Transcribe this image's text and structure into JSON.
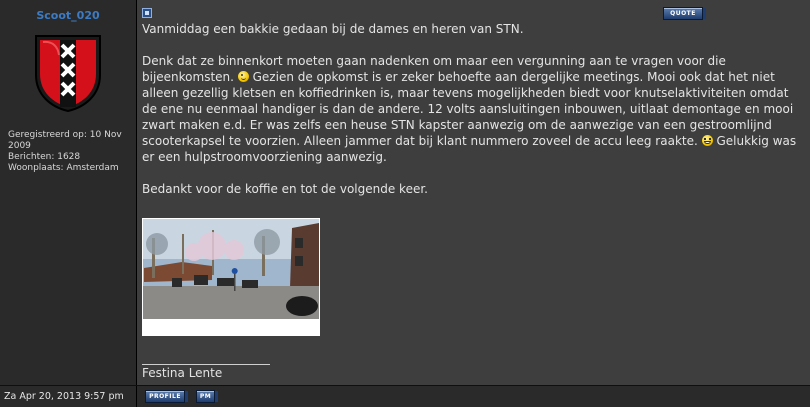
{
  "author": {
    "username": "Scoot_020",
    "avatar_icon": "amsterdam-xxx-shield-icon",
    "info": [
      "Geregistreerd op: 10 Nov 2009",
      "Berichten: 1628",
      "Woonplaats: Amsterdam"
    ]
  },
  "toolbar": {
    "quote_label": "QUOTE",
    "profile_label": "PROFILE",
    "pm_label": "PM"
  },
  "post": {
    "line1": "Vanmiddag een bakkie gedaan bij de dames en heren van STN.",
    "p2_a": "Denk dat ze binnenkort moeten gaan nadenken om maar een vergunning aan te vragen voor die bijeenkomsten.",
    "p2_b": "Gezien de opkomst is er zeker behoefte aan dergelijke meetings. Mooi ook dat het niet alleen gezellig kletsen en koffiedrinken is, maar tevens mogelijkheden biedt voor knutselaktiviteiten omdat de ene nu eenmaal handiger is dan de andere. 12 volts aansluitingen inbouwen, uitlaat demontage en mooi zwart maken e.d. Er was zelfs een heuse STN kapster aanwezig om de aanwezige van een gestroomlijnd scooterkapsel te voorzien. Alleen jammer dat bij klant nummero zoveel de accu leeg raakte.",
    "p2_c": "Gelukkig was er een hulpstroomvoorziening aanwezig.",
    "p3": "Bedankt voor de koffie en tot de volgende keer.",
    "signature": "Festina Lente"
  },
  "footer": {
    "date": "Za Apr 20, 2013 9:57 pm"
  },
  "colors": {
    "username": "#3d7cc4",
    "content_bg": "#3e3e3e",
    "author_bg": "#2a2a2a",
    "button": "#2f5289"
  }
}
